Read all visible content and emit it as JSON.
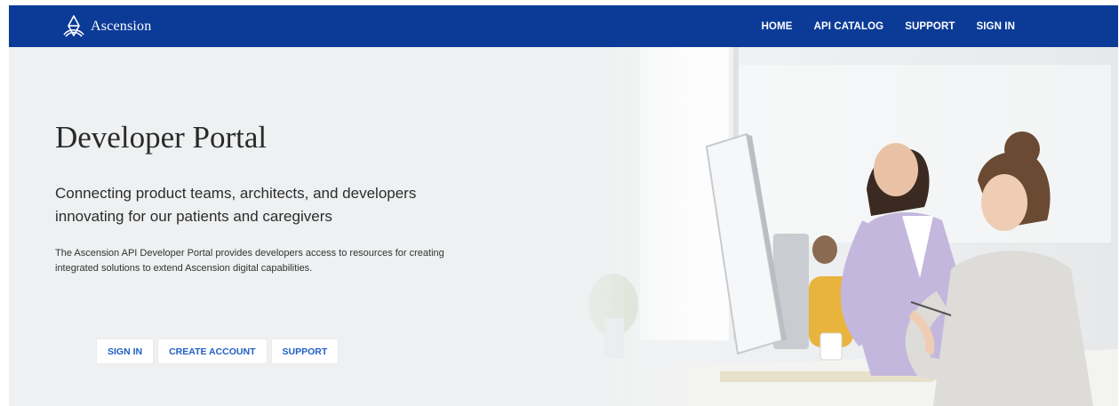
{
  "nav": {
    "brand": "Ascension",
    "links": [
      {
        "label": "HOME"
      },
      {
        "label": "API CATALOG"
      },
      {
        "label": "SUPPORT"
      },
      {
        "label": "SIGN IN"
      }
    ]
  },
  "hero": {
    "title": "Developer Portal",
    "subtitle": "Connecting product teams, architects, and developers innovating for our patients and caregivers",
    "description": "The Ascension API Developer Portal provides developers access to resources for creating integrated solutions to extend Ascension digital capabilities.",
    "buttons": [
      {
        "label": "SIGN IN"
      },
      {
        "label": "CREATE ACCOUNT"
      },
      {
        "label": "SUPPORT"
      }
    ]
  },
  "colors": {
    "nav_bg": "#0b3b97",
    "hero_bg": "#eef0f1",
    "button_text": "#1f5fc4"
  },
  "icons": {
    "logo": "ascension-cross-logo-icon"
  }
}
